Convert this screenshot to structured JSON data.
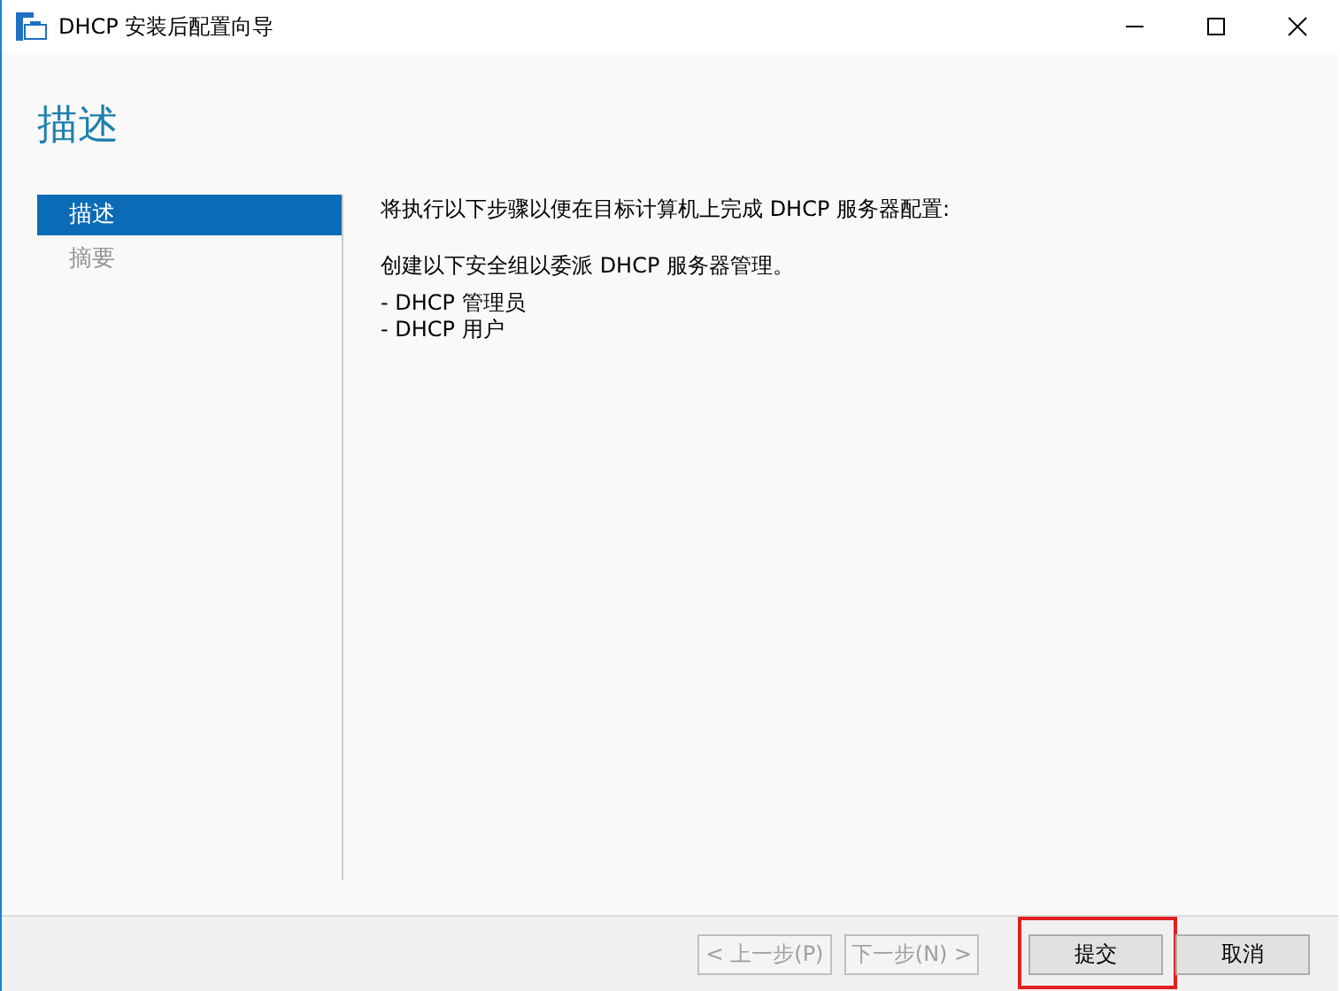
{
  "window": {
    "title": "DHCP 安装后配置向导"
  },
  "heading": "描述",
  "sidebar": {
    "items": [
      {
        "label": "描述",
        "selected": true,
        "disabled": false
      },
      {
        "label": "摘要",
        "selected": false,
        "disabled": true
      }
    ]
  },
  "content": {
    "paragraphs": [
      "将执行以下步骤以便在目标计算机上完成 DHCP 服务器配置:",
      "创建以下安全组以委派 DHCP 服务器管理。"
    ],
    "list": [
      "- DHCP 管理员",
      "- DHCP 用户"
    ]
  },
  "buttons": [
    {
      "label": "< 上一步(P)",
      "disabled": true,
      "highlighted": false
    },
    {
      "label": "下一步(N) >",
      "disabled": true,
      "highlighted": false
    },
    {
      "label": "提交",
      "disabled": false,
      "highlighted": true
    },
    {
      "label": "取消",
      "disabled": false,
      "highlighted": false
    }
  ]
}
